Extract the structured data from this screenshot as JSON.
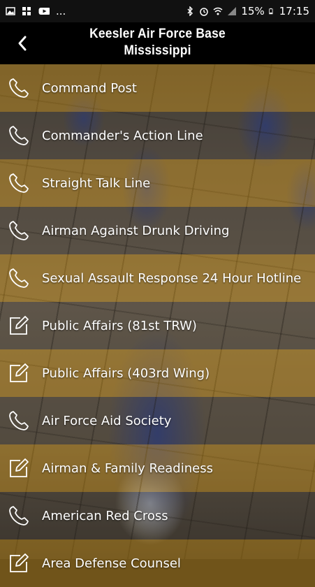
{
  "status_bar": {
    "battery": "15%",
    "time": "17:15",
    "more": "..."
  },
  "header": {
    "title_line1": "Keesler Air Force Base",
    "title_line2": "Mississippi"
  },
  "items": [
    {
      "label": "Command Post",
      "icon": "phone-icon"
    },
    {
      "label": "Commander's Action Line",
      "icon": "phone-icon"
    },
    {
      "label": "Straight Talk Line",
      "icon": "phone-icon"
    },
    {
      "label": "Airman Against Drunk Driving",
      "icon": "phone-icon"
    },
    {
      "label": "Sexual Assault Response 24 Hour Hotline",
      "icon": "phone-icon"
    },
    {
      "label": "Public Affairs (81st TRW)",
      "icon": "edit-icon"
    },
    {
      "label": "Public Affairs (403rd Wing)",
      "icon": "edit-icon"
    },
    {
      "label": "Air Force Aid Society",
      "icon": "phone-icon"
    },
    {
      "label": "Airman & Family Readiness",
      "icon": "edit-icon"
    },
    {
      "label": "American Red Cross",
      "icon": "phone-icon"
    },
    {
      "label": "Area Defense Counsel",
      "icon": "edit-icon"
    }
  ],
  "colors": {
    "odd_row": "#d29614",
    "header_bg": "#000000"
  }
}
